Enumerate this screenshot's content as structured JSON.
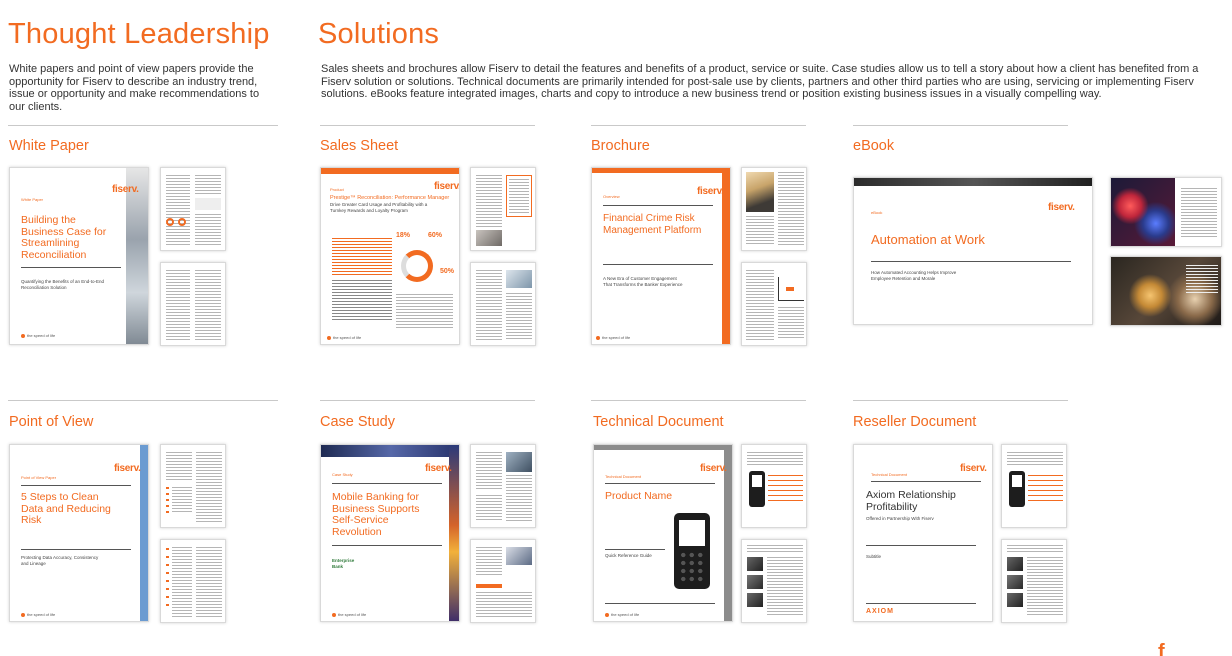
{
  "thought_leadership": {
    "title": "Thought Leadership",
    "description": "White papers and point of view papers provide the opportunity for Fiserv to describe an industry trend, issue or opportunity and make recommendations to our clients."
  },
  "solutions": {
    "title": "Solutions",
    "description": "Sales sheets and brochures allow Fiserv to detail the features and benefits of a product, service or suite. Case studies allow us to tell a story about how a client has benefited from a Fiserv solution or solutions. Technical documents are primarily intended for post-sale use by clients, partners and other third parties who are using, servicing or implementing Fiserv solutions. eBooks feature integrated images, charts and copy to introduce a new business trend or position existing business issues in a visually compelling way."
  },
  "brand": {
    "logo": "fiserv.",
    "accent": "#f26b21",
    "footer": "the speed of life"
  },
  "white_paper": {
    "label": "White Paper",
    "tag": "White Paper",
    "title": "Building the Business Case for Streamlining Reconciliation",
    "subtitle": "Quantifying the Benefits of an End-to-End Reconciliation Solution"
  },
  "sales_sheet": {
    "label": "Sales Sheet",
    "tag": "Product",
    "title": "Prestige™ Reconciliation: Performance Manager",
    "subtitle": "Drive Greater Card Usage and Profitability with a Turnkey Rewards and Loyalty Program",
    "stat_a": "18%",
    "stat_b": "60%",
    "stat_c": "50%"
  },
  "brochure": {
    "label": "Brochure",
    "tag": "Overview",
    "title": "Financial Crime Risk Management Platform",
    "subtitle": "A New Era of Customer Engagement That Transforms the Banker Experience"
  },
  "ebook": {
    "label": "eBook",
    "tag": "eBook",
    "title": "Automation at Work",
    "subtitle": "How Automated Accounting Helps Improve Employee Retention and Morale"
  },
  "point_of_view": {
    "label": "Point of View",
    "tag": "Point of View Paper",
    "title": "5 Steps to Clean Data and Reducing Risk",
    "subtitle": "Protecting Data Accuracy, Consistency and Lineage"
  },
  "case_study": {
    "label": "Case Study",
    "tag": "Case Study",
    "title": "Mobile Banking for Business Supports Self-Service Revolution",
    "client": "Enterprise Bank"
  },
  "technical_document": {
    "label": "Technical Document",
    "tag": "Technical Document",
    "title": "Product Name",
    "subtitle": "Quick Reference Guide"
  },
  "reseller_document": {
    "label": "Reseller Document",
    "tag": "Technical Document",
    "title": "Axiom Relationship Profitability",
    "subtitle": "Offered in Partnership With Fiserv",
    "detail": "Subtitle",
    "partner_logo": "AXIOM"
  },
  "colors": {
    "accent": "#f26b21",
    "rule": "#c9c9c9",
    "pov_bar": "#6b9bd1",
    "tech_bar": "#8c8c8c"
  }
}
